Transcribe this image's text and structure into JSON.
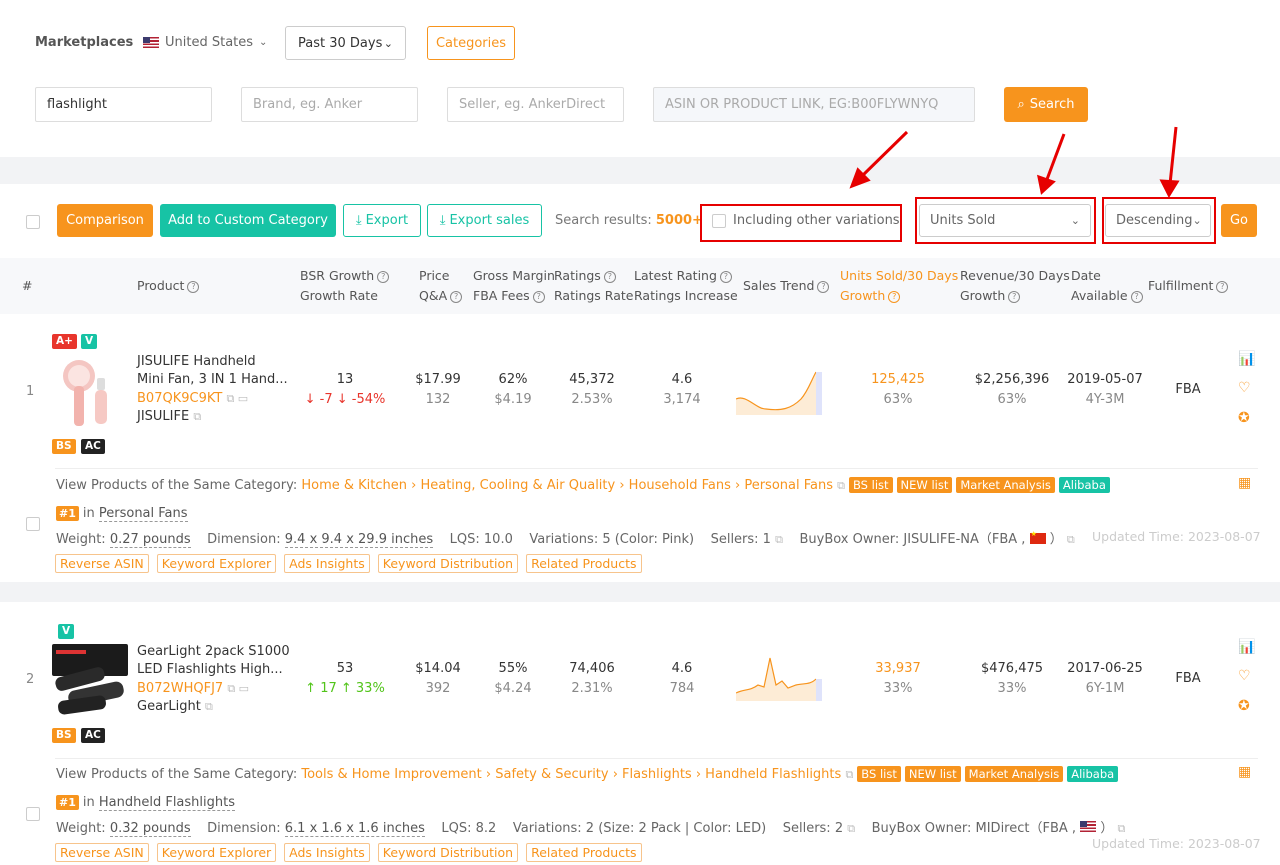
{
  "filters": {
    "marketplaces_label": "Marketplaces",
    "country": "United States",
    "period": "Past 30 Days",
    "categories_btn": "Categories",
    "keyword_value": "flashlight",
    "brand_placeholder": "Brand, eg. Anker",
    "seller_placeholder": "Seller, eg. AnkerDirect",
    "asin_placeholder": "ASIN OR PRODUCT LINK, EG:B00FLYWNYQ",
    "search_btn": "Search"
  },
  "toolbar": {
    "comparison": "Comparison",
    "add_custom": "Add to Custom Category",
    "export": "Export",
    "export_sales": "Export sales",
    "results_label": "Search results:",
    "results_count": "5000+",
    "variations_label": "Including other variations",
    "sort_field": "Units Sold",
    "sort_order": "Descending",
    "go": "Go"
  },
  "headers": {
    "num": "#",
    "product": "Product",
    "bsr1": "BSR Growth",
    "bsr2": "Growth Rate",
    "price1": "Price",
    "price2": "Q&A",
    "gm1": "Gross Margin",
    "gm2": "FBA Fees",
    "rat1": "Ratings",
    "rat2": "Ratings Rate",
    "lr1": "Latest Rating",
    "lr2": "Ratings Increase",
    "trend": "Sales Trend",
    "us1": "Units Sold/30 Days",
    "us2": "Growth",
    "rev1": "Revenue/30 Days",
    "rev2": "Growth",
    "date1": "Date",
    "date2": "Available",
    "ful": "Fulfillment"
  },
  "products": [
    {
      "index": "1",
      "badge_top": [
        "A+",
        "V"
      ],
      "badge_bottom": [
        "BS",
        "AC"
      ],
      "title1": "JISULIFE Handheld",
      "title2": "Mini Fan, 3 IN 1 Hand...",
      "asin": "B07QK9C9KT",
      "brand": "JISULIFE",
      "bsr": "13",
      "bsr_change": "↓ -7",
      "bsr_rate": "↓ -54%",
      "price": "$17.99",
      "qa": "132",
      "margin": "62%",
      "fba": "$4.19",
      "ratings": "45,372",
      "ratings_rate": "2.53%",
      "latest_rating": "4.6",
      "ratings_inc": "3,174",
      "units": "125,425",
      "units_growth": "63%",
      "revenue": "$2,256,396",
      "rev_growth": "63%",
      "date": "2019-05-07",
      "age": "4Y-3M",
      "fulfillment": "FBA",
      "cat_label": "View Products of the Same Category:",
      "cat_path": "Home & Kitchen › Heating, Cooling & Air Quality › Household Fans › Personal Fans",
      "tags": [
        "BS list",
        "NEW list",
        "Market Analysis",
        "Alibaba"
      ],
      "rank": "#1",
      "rank_in": "in",
      "rank_cat": "Personal Fans",
      "weight_label": "Weight:",
      "weight": "0.27 pounds",
      "dim_label": "Dimension:",
      "dim": "9.4 x 9.4 x 29.9 inches",
      "lqs": "LQS: 10.0",
      "variations": "Variations: 5 (Color: Pink)",
      "sellers": "Sellers: 1",
      "buybox": "BuyBox Owner:  JISULIFE-NA（FBA ,",
      "updated": "Updated Time: 2023-08-07",
      "tools": [
        "Reverse ASIN",
        "Keyword Explorer",
        "Ads Insights",
        "Keyword Distribution",
        "Related Products"
      ]
    },
    {
      "index": "2",
      "badge_top": [
        "V"
      ],
      "badge_bottom": [
        "BS",
        "AC"
      ],
      "title1": "GearLight 2pack S1000",
      "title2": "LED Flashlights High...",
      "asin": "B072WHQFJ7",
      "brand": "GearLight",
      "bsr": "53",
      "bsr_change": "↑ 17",
      "bsr_rate": "↑ 33%",
      "price": "$14.04",
      "qa": "392",
      "margin": "55%",
      "fba": "$4.24",
      "ratings": "74,406",
      "ratings_rate": "2.31%",
      "latest_rating": "4.6",
      "ratings_inc": "784",
      "units": "33,937",
      "units_growth": "33%",
      "revenue": "$476,475",
      "rev_growth": "33%",
      "date": "2017-06-25",
      "age": "6Y-1M",
      "fulfillment": "FBA",
      "cat_label": "View Products of the Same Category:",
      "cat_path": "Tools & Home Improvement › Safety & Security › Flashlights › Handheld Flashlights",
      "tags": [
        "BS list",
        "NEW list",
        "Market Analysis",
        "Alibaba"
      ],
      "rank": "#1",
      "rank_in": "in",
      "rank_cat": "Handheld Flashlights",
      "weight_label": "Weight:",
      "weight": "0.32 pounds",
      "dim_label": "Dimension:",
      "dim": "6.1 x 1.6 x 1.6 inches",
      "lqs": "LQS: 8.2",
      "variations": "Variations: 2 (Size: 2 Pack | Color: LED)",
      "sellers": "Sellers: 2",
      "buybox": "BuyBox Owner:  MIDirect（FBA ,",
      "updated": "Updated Time: 2023-08-07",
      "tools": [
        "Reverse ASIN",
        "Keyword Explorer",
        "Ads Insights",
        "Keyword Distribution",
        "Related Products"
      ]
    }
  ]
}
